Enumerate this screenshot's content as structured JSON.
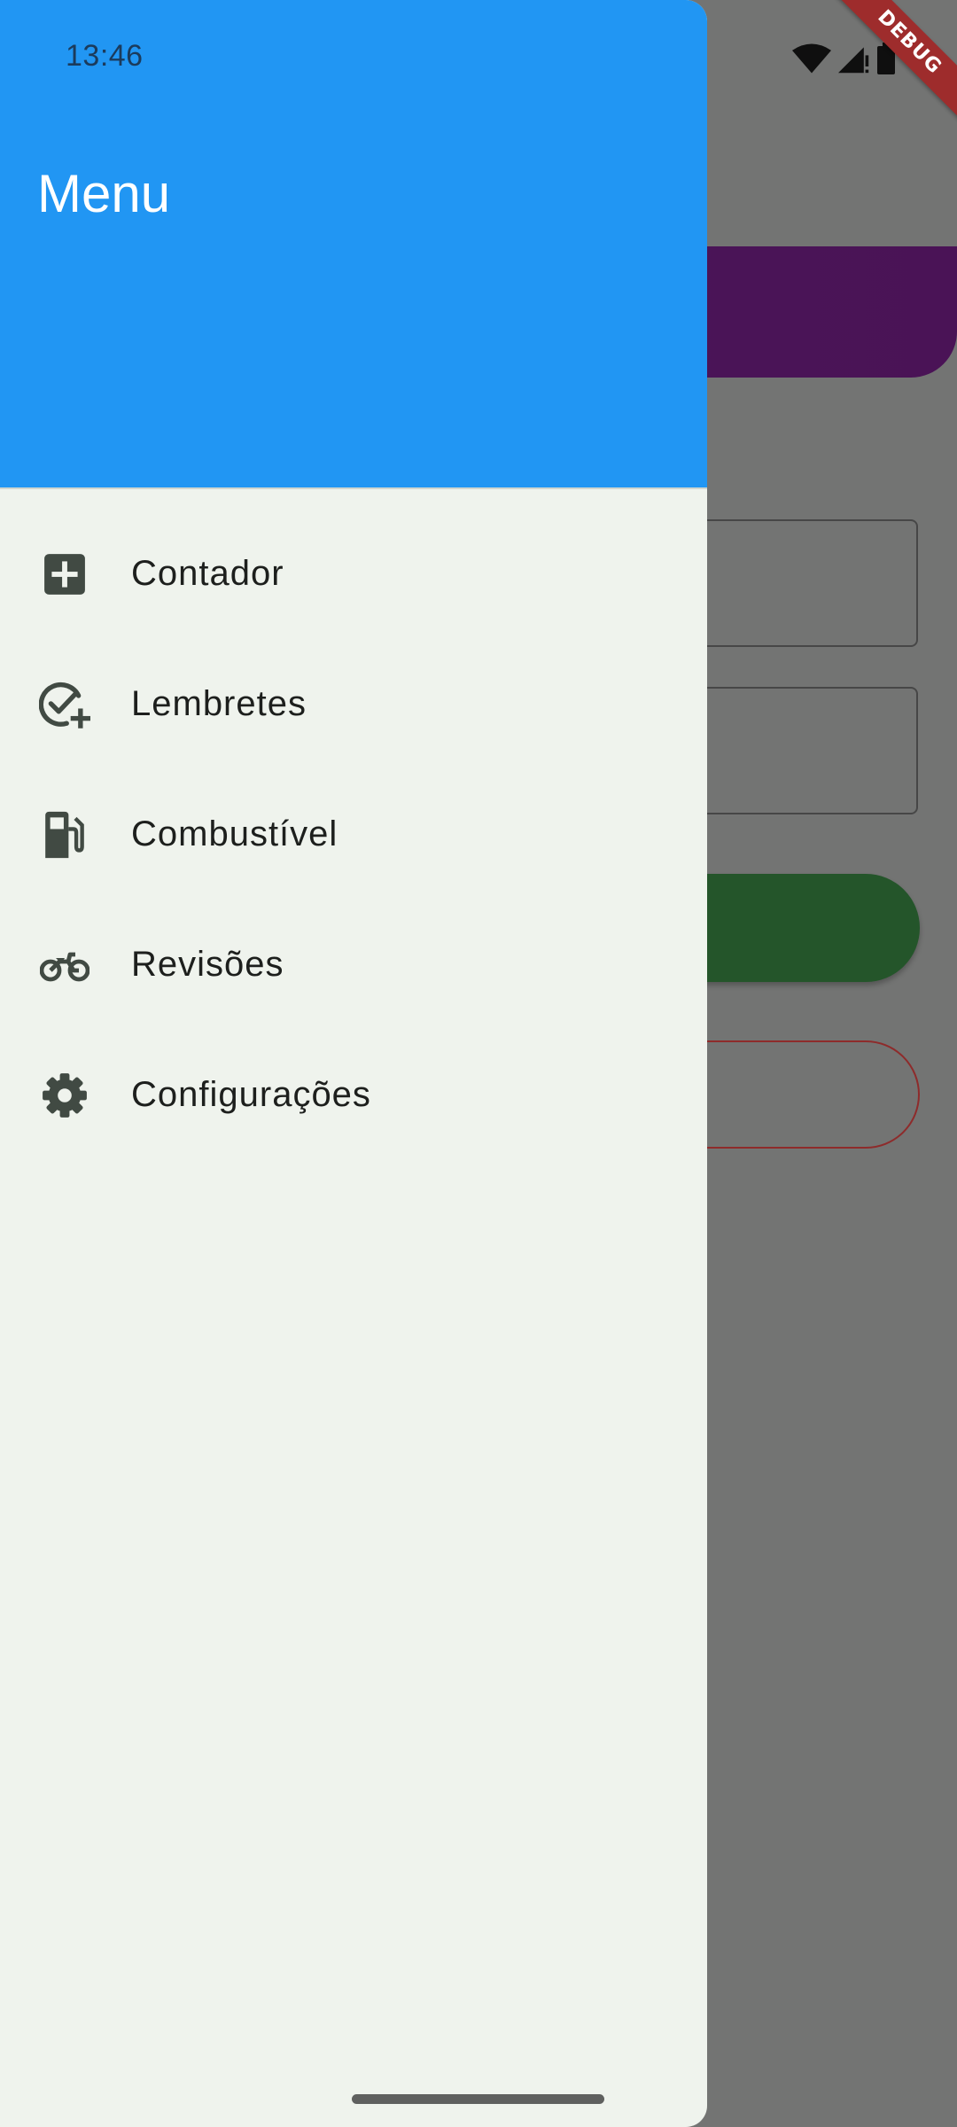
{
  "status_bar": {
    "time": "13:46",
    "icons": [
      "wifi-icon",
      "cell-signal-icon",
      "battery-icon"
    ]
  },
  "debug_banner": {
    "label": "DEBUG",
    "color": "#9e2c2c"
  },
  "drawer": {
    "title": "Menu",
    "header_color": "#2196f3",
    "background_color": "#eff3ed",
    "items": [
      {
        "label": "Contador",
        "icon": "add-box-icon"
      },
      {
        "label": "Lembretes",
        "icon": "task-add-icon"
      },
      {
        "label": "Combustível",
        "icon": "gas-station-icon"
      },
      {
        "label": "Revisões",
        "icon": "motorcycle-icon"
      },
      {
        "label": "Configurações",
        "icon": "settings-gear-icon"
      }
    ]
  },
  "background_app": {
    "accent_purple": "#4a1558",
    "button_green": "#24552a",
    "button_outline_red": "#8e2b2b"
  }
}
